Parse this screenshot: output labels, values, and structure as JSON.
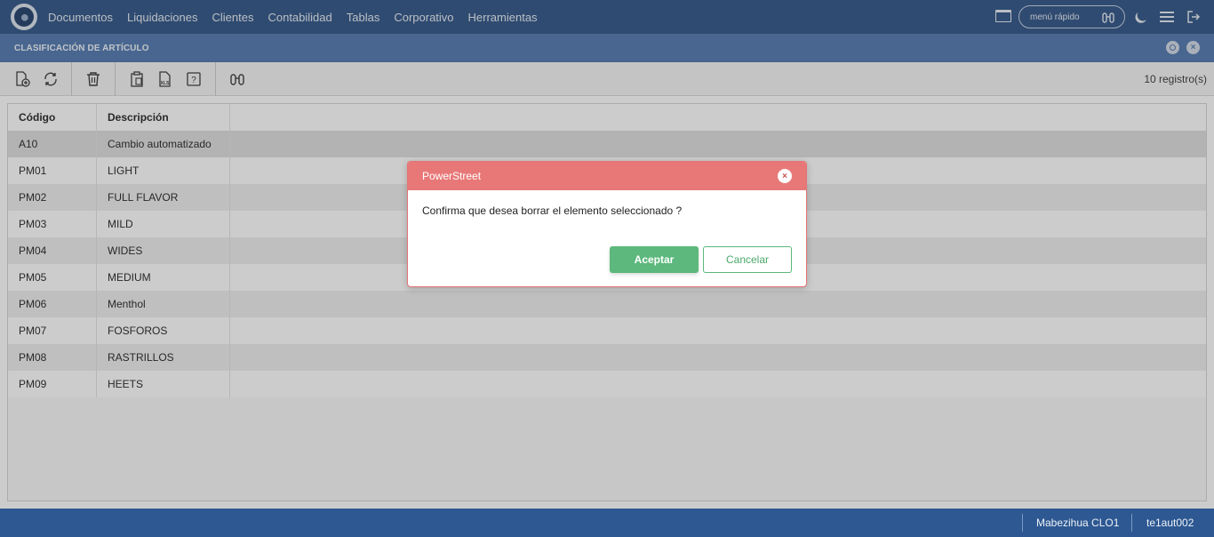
{
  "nav": {
    "items": [
      "Documentos",
      "Liquidaciones",
      "Clientes",
      "Contabilidad",
      "Tablas",
      "Corporativo",
      "Herramientas"
    ],
    "quick_search_placeholder": "menú rápido"
  },
  "page": {
    "title": "CLASIFICACIÓN DE ARTÍCULO"
  },
  "toolbar": {
    "records": "10 registro(s)",
    "icons": [
      "new-document-icon",
      "refresh-icon",
      "trash-icon",
      "clipboard-icon",
      "xls-export-icon",
      "help-icon",
      "binoculars-icon"
    ]
  },
  "grid": {
    "columns": [
      "Código",
      "Descripción"
    ],
    "rows": [
      {
        "code": "A10",
        "desc": "Cambio automatizado"
      },
      {
        "code": "PM01",
        "desc": "LIGHT"
      },
      {
        "code": "PM02",
        "desc": "FULL FLAVOR"
      },
      {
        "code": "PM03",
        "desc": "MILD"
      },
      {
        "code": "PM04",
        "desc": "WIDES"
      },
      {
        "code": "PM05",
        "desc": "MEDIUM"
      },
      {
        "code": "PM06",
        "desc": "Menthol"
      },
      {
        "code": "PM07",
        "desc": "FOSFOROS"
      },
      {
        "code": "PM08",
        "desc": "RASTRILLOS"
      },
      {
        "code": "PM09",
        "desc": "HEETS"
      }
    ]
  },
  "modal": {
    "title": "PowerStreet",
    "message": "Confirma que desea borrar el elemento seleccionado ?",
    "ok_label": "Aceptar",
    "cancel_label": "Cancelar"
  },
  "footer": {
    "user": "Mabezihua CLO1",
    "station": "te1aut002"
  },
  "colors": {
    "navbar": "#3b5e8e",
    "titlebar": "#5a80b5",
    "modal_header": "#e87878",
    "accept": "#5cb87c",
    "footer": "#2d5892"
  }
}
